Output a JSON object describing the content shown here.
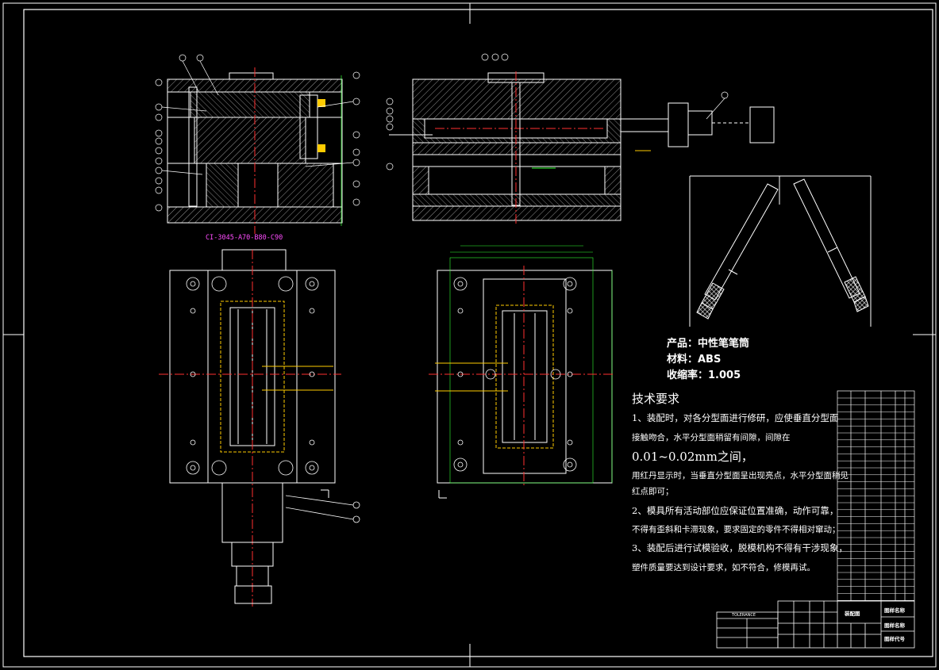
{
  "mold_code": "CI-3045-A70-B80-C90",
  "product": {
    "name": "产品：中性笔笔筒",
    "material": "材料：ABS",
    "shrinkage": "收缩率：1.005"
  },
  "tech_requirements": {
    "title": "技术要求",
    "lines": [
      "1、装配时，对各分型面进行修研，应使垂直分型面",
      "接触吻合，水平分型面稍留有间隙，间隙在",
      "0.01~0.02mm之间，",
      "用红丹显示时，当垂直分型面呈出现亮点，水平分型面稍见",
      "红点即可；",
      "2、模具所有活动部位应保证位置准确，动作可靠，",
      "不得有歪斜和卡滞现象，要求固定的零件不得相对窜动；",
      "3、装配后进行试模验收，脱模机构不得有干涉现象，",
      "塑件质量要达到设计要求，如不符合，修模再试。"
    ]
  },
  "title_block": {
    "drawing_name_1": "图样名称",
    "drawing_name_2": "图样名称",
    "drawing_code": "图样代号",
    "assembly": "装配图",
    "tolerance": "TOLERANCE"
  },
  "colors": {
    "background": "#000000",
    "line": "#ffffff",
    "centerline": "#ff3030",
    "dimension": "#33ff33",
    "hidden": "#ffff33",
    "accent": "#ff4dff"
  }
}
